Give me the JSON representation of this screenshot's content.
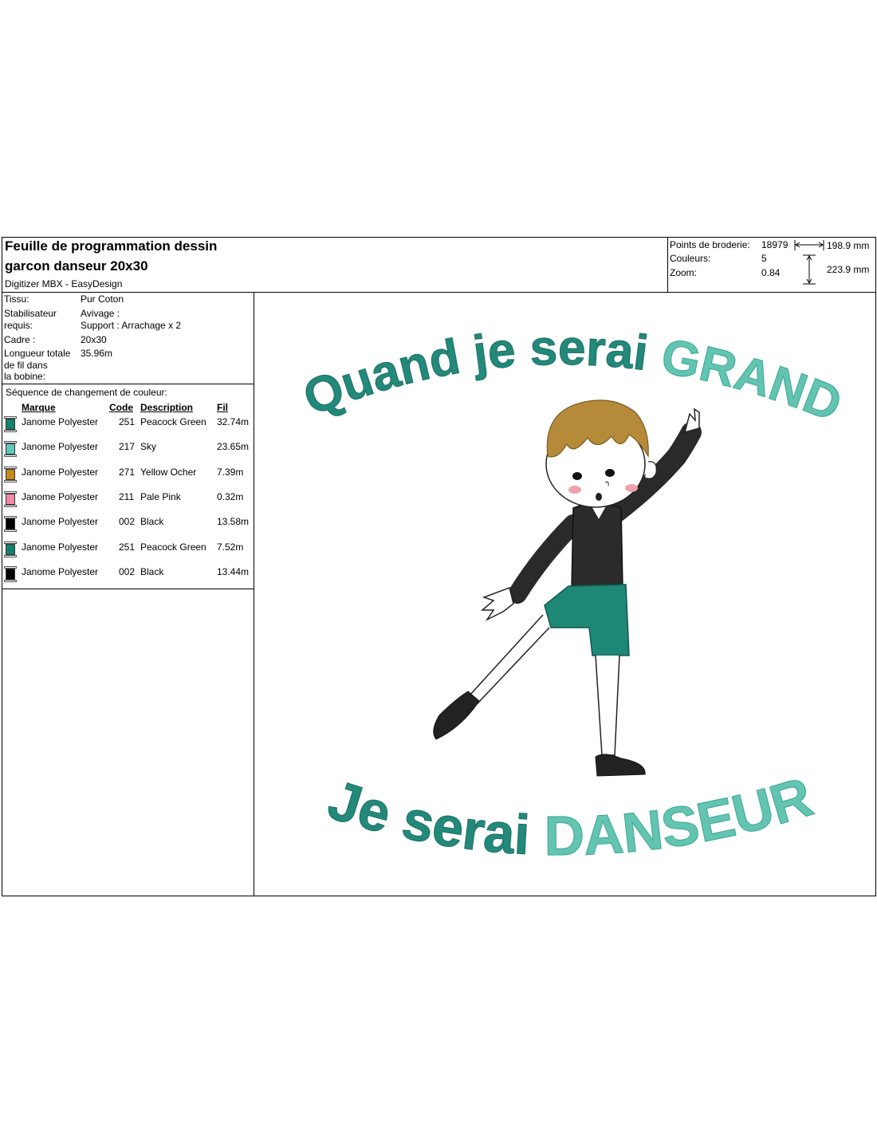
{
  "header": {
    "title_line1": "Feuille de programmation dessin",
    "title_line2": "garcon danseur 20x30",
    "software": "Digitizer MBX - EasyDesign",
    "stitch_label": "Points de broderie:",
    "stitch_value": "18979",
    "colors_label": "Couleurs:",
    "colors_value": "5",
    "zoom_label": "Zoom:",
    "zoom_value": "0.84",
    "width": "198.9 mm",
    "height": "223.9 mm"
  },
  "info": {
    "fabric_label": "Tissu:",
    "fabric_value": "Pur Coton",
    "stabilizer_label_1": "Stabilisateur",
    "stabilizer_label_2": "requis:",
    "stabilizer_value_1": "Avivage :",
    "stabilizer_value_2": "Support : Arrachage x 2",
    "frame_label": "Cadre :",
    "frame_value": "20x30",
    "length_label_1": "Longueur totale",
    "length_label_2": "de fil dans",
    "length_label_3": "la bobine:",
    "length_value": "35.96m"
  },
  "sequence": {
    "title": "Séquence de changement de couleur:",
    "columns": {
      "brand": "Marque",
      "code": "Code",
      "description": "Description",
      "thread": "Fil"
    },
    "rows": [
      {
        "brand": "Janome Polyester",
        "code": "251",
        "description": "Peacock Green",
        "thread": "32.74m",
        "color": "#16806f"
      },
      {
        "brand": "Janome Polyester",
        "code": "217",
        "description": "Sky",
        "thread": "23.65m",
        "color": "#5fc6bc"
      },
      {
        "brand": "Janome Polyester",
        "code": "271",
        "description": "Yellow Ocher",
        "thread": "7.39m",
        "color": "#c58a1c"
      },
      {
        "brand": "Janome Polyester",
        "code": "211",
        "description": "Pale Pink",
        "thread": "0.32m",
        "color": "#ee8aa6"
      },
      {
        "brand": "Janome Polyester",
        "code": "002",
        "description": "Black",
        "thread": "13.58m",
        "color": "#000000"
      },
      {
        "brand": "Janome Polyester",
        "code": "251",
        "description": "Peacock Green",
        "thread": "7.52m",
        "color": "#16806f"
      },
      {
        "brand": "Janome Polyester",
        "code": "002",
        "description": "Black",
        "thread": "13.44m",
        "color": "#000000"
      }
    ]
  },
  "design": {
    "top_text_a": "Quand je serai",
    "top_text_b": "GRAND",
    "bottom_text_a": "Je serai",
    "bottom_text_b": "DANSEUR",
    "dark_green": "#23897a",
    "light_green": "#63c4b1"
  }
}
